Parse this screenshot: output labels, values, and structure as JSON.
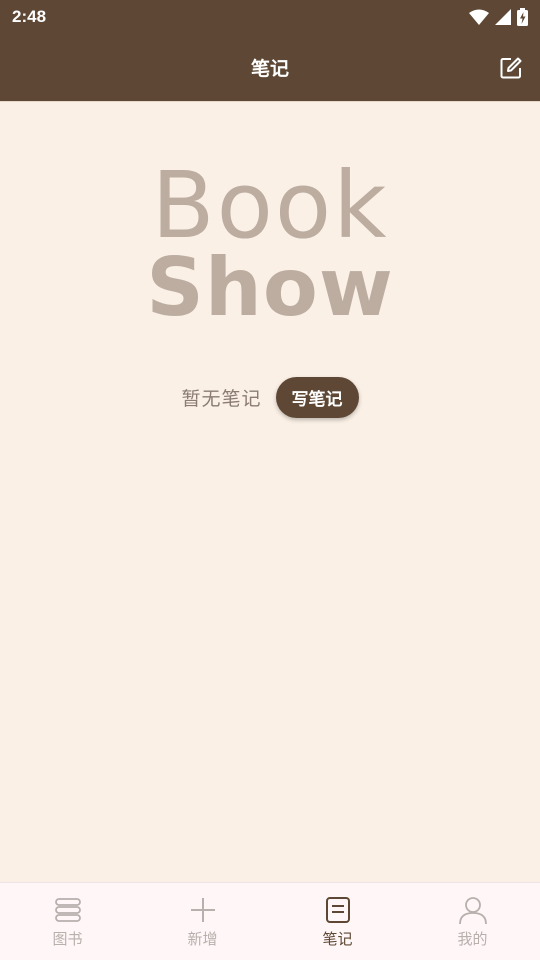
{
  "status_bar": {
    "time": "2:48"
  },
  "app_bar": {
    "title": "笔记"
  },
  "logo": {
    "line1": "Book",
    "line2": "Show"
  },
  "empty_state": {
    "message": "暂无笔记",
    "button_label": "写笔记"
  },
  "bottom_nav": {
    "items": [
      {
        "label": "图书",
        "icon": "books-icon"
      },
      {
        "label": "新增",
        "icon": "plus-icon"
      },
      {
        "label": "笔记",
        "icon": "note-icon",
        "active": true
      },
      {
        "label": "我的",
        "icon": "person-icon"
      }
    ]
  },
  "colors": {
    "primary": "#5E4835",
    "background": "#FAF0E6",
    "logo": "#BCADA0",
    "nav_inactive": "#B8B0AD"
  }
}
